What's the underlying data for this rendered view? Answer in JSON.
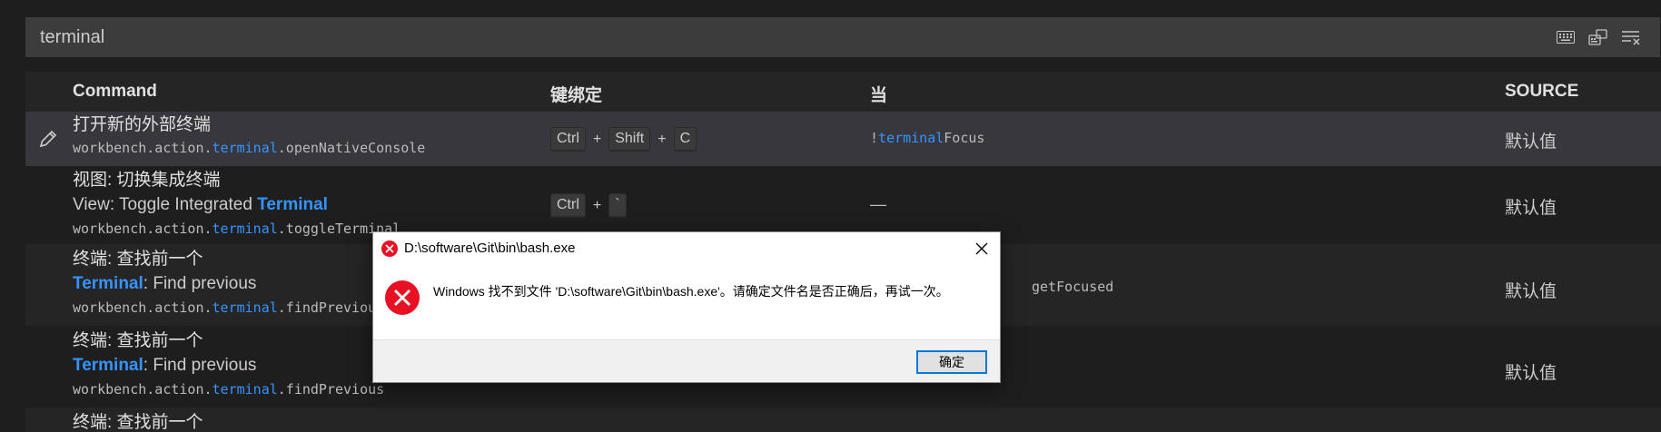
{
  "search": {
    "value": "terminal",
    "placeholder": ""
  },
  "toolbar": {
    "keyboard_icon": "keyboard-icon",
    "record_icon": "record-keys-icon",
    "clear_icon": "clear-filter-icon"
  },
  "columns": {
    "command": "Command",
    "keybinding": "键绑定",
    "when": "当",
    "source": "SOURCE"
  },
  "rows": [
    {
      "title": "打开新的外部终端",
      "label_pre": "",
      "label_hl": "",
      "label_post": "",
      "id_pre": "workbench.action.",
      "id_hl": "terminal",
      "id_post": ".openNativeConsole",
      "keys": [
        "Ctrl",
        "Shift",
        "C"
      ],
      "when_pre": "!",
      "when_hl": "terminal",
      "when_post": "Focus",
      "source": "默认值"
    },
    {
      "title": "视图: 切换集成终端",
      "label_pre": "View: Toggle Integrated ",
      "label_hl": "Terminal",
      "label_post": "",
      "id_pre": "workbench.action.",
      "id_hl": "terminal",
      "id_post": ".toggleTerminal",
      "keys": [
        "Ctrl",
        "`"
      ],
      "when": "—",
      "source": "默认值"
    },
    {
      "title": "终端: 查找前一个",
      "label_pre": "",
      "label_hl": "Terminal",
      "label_post": ": Find previous",
      "id_pre": "workbench.action.",
      "id_hl": "terminal",
      "id_post": ".findPrevious",
      "when_partial": "getFocused",
      "source": "默认值"
    },
    {
      "title": "终端: 查找前一个",
      "label_pre": "",
      "label_hl": "Terminal",
      "label_post": ": Find previous",
      "id_pre": "workbench.action.",
      "id_hl": "terminal",
      "id_post": ".findPrevious",
      "source": "默认值"
    },
    {
      "title": "终端: 查找前一个"
    }
  ],
  "dialog": {
    "title": "D:\\software\\Git\\bin\\bash.exe",
    "message": "Windows 找不到文件 'D:\\software\\Git\\bin\\bash.exe'。请确定文件名是否正确后，再试一次。",
    "ok_label": "确定"
  },
  "colors": {
    "accent": "#3794ff",
    "background": "#1e1e1e",
    "error": "#e81123",
    "button_focus": "#0078d7"
  }
}
